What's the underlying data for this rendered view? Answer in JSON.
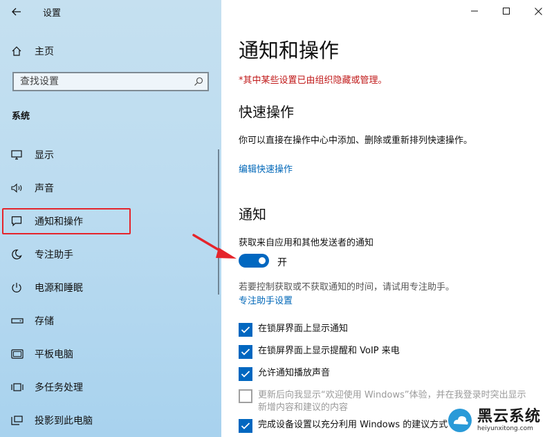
{
  "window": {
    "title": "设置"
  },
  "sidebar": {
    "home": "主页",
    "search_placeholder": "查找设置",
    "section": "系统",
    "items": [
      {
        "label": "显示",
        "icon": "monitor-icon"
      },
      {
        "label": "声音",
        "icon": "speaker-icon"
      },
      {
        "label": "通知和操作",
        "icon": "message-icon",
        "selected": true
      },
      {
        "label": "专注助手",
        "icon": "moon-icon"
      },
      {
        "label": "电源和睡眠",
        "icon": "power-icon"
      },
      {
        "label": "存储",
        "icon": "storage-icon"
      },
      {
        "label": "平板电脑",
        "icon": "tablet-icon"
      },
      {
        "label": "多任务处理",
        "icon": "multitask-icon"
      },
      {
        "label": "投影到此电脑",
        "icon": "projector-icon"
      }
    ]
  },
  "content": {
    "title": "通知和操作",
    "org_note": "*其中某些设置已由组织隐藏或管理。",
    "quick_actions": {
      "heading": "快速操作",
      "desc": "你可以直接在操作中心中添加、删除或重新排列快速操作。",
      "edit_link": "编辑快速操作"
    },
    "notifications": {
      "heading": "通知",
      "toggle_label": "获取来自应用和其他发送者的通知",
      "toggle_state": "开",
      "toggle_on": true,
      "hint": "若要控制获取或不获取通知的时间，请试用专注助手。",
      "focus_link": "专注助手设置",
      "checkboxes": [
        {
          "label": "在锁屏界面上显示通知",
          "checked": true,
          "disabled": false
        },
        {
          "label": "在锁屏界面上显示提醒和 VoIP 来电",
          "checked": true,
          "disabled": false
        },
        {
          "label": "允许通知播放声音",
          "checked": true,
          "disabled": false
        },
        {
          "label": "更新后向我显示“欢迎使用 Windows”体验，并在我登录时突出显示新增内容和建议的内容",
          "checked": false,
          "disabled": true
        },
        {
          "label": "完成设备设置以充分利用 Windows 的建议方式",
          "checked": true,
          "disabled": false
        }
      ]
    }
  },
  "watermark": {
    "text": "黑云系统",
    "url": "heiyunxitong.com"
  },
  "colors": {
    "accent": "#0067c0",
    "link": "#0067b8",
    "warning": "#c01818",
    "highlight": "#e5242b"
  }
}
